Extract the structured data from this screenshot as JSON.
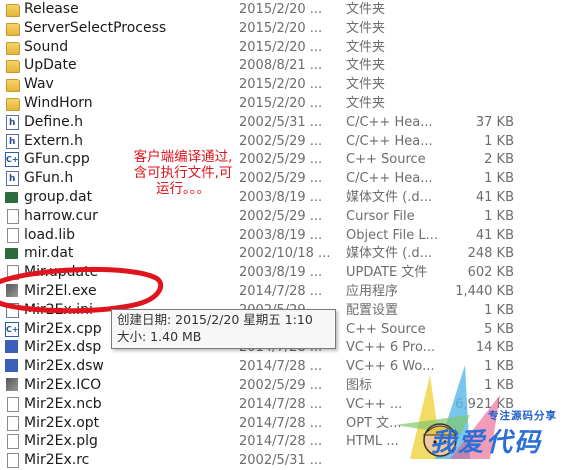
{
  "files": [
    {
      "name": "Release",
      "date": "2015/2/20 ...",
      "type": "文件夹",
      "size": "",
      "icon": "folder-icon"
    },
    {
      "name": "ServerSelectProcess",
      "date": "2015/2/20 ...",
      "type": "文件夹",
      "size": "",
      "icon": "folder-icon"
    },
    {
      "name": "Sound",
      "date": "2015/2/20 ...",
      "type": "文件夹",
      "size": "",
      "icon": "folder-icon"
    },
    {
      "name": "UpDate",
      "date": "2008/8/21 ...",
      "type": "文件夹",
      "size": "",
      "icon": "folder-icon"
    },
    {
      "name": "Wav",
      "date": "2015/2/20 ...",
      "type": "文件夹",
      "size": "",
      "icon": "folder-icon"
    },
    {
      "name": "WindHorn",
      "date": "2015/2/20 ...",
      "type": "文件夹",
      "size": "",
      "icon": "folder-icon"
    },
    {
      "name": "Define.h",
      "date": "2002/5/31 ...",
      "type": "C/C++ Hea...",
      "size": "37 KB",
      "icon": "h-file-icon"
    },
    {
      "name": "Extern.h",
      "date": "2002/5/29 ...",
      "type": "C/C++ Hea...",
      "size": "1 KB",
      "icon": "h-file-icon"
    },
    {
      "name": "GFun.cpp",
      "date": "2002/5/29 ...",
      "type": "C++ Source",
      "size": "2 KB",
      "icon": "cpp-file-icon"
    },
    {
      "name": "GFun.h",
      "date": "2002/5/29 ...",
      "type": "C/C++ Hea...",
      "size": "1 KB",
      "icon": "h-file-icon"
    },
    {
      "name": "group.dat",
      "date": "2003/8/19 ...",
      "type": "媒体文件 (.d...",
      "size": "41 KB",
      "icon": "dat-file-icon"
    },
    {
      "name": "harrow.cur",
      "date": "2002/5/29 ...",
      "type": "Cursor File",
      "size": "1 KB",
      "icon": "cur-file-icon"
    },
    {
      "name": "load.lib",
      "date": "2003/8/19 ...",
      "type": "Object File L...",
      "size": "41 KB",
      "icon": "file-icon"
    },
    {
      "name": "mir.dat",
      "date": "2002/10/18 ...",
      "type": "媒体文件 (.d...",
      "size": "248 KB",
      "icon": "dat-file-icon"
    },
    {
      "name": "Mir.update",
      "date": "2003/8/19 ...",
      "type": "UPDATE 文件",
      "size": "602 KB",
      "icon": "file-icon"
    },
    {
      "name": "Mir2El.exe",
      "date": "2014/7/28 ...",
      "type": "应用程序",
      "size": "1,440 KB",
      "icon": "exe-file-icon"
    },
    {
      "name": "Mir2Ex.ini",
      "date": "2002/5/29 ...",
      "type": "配置设置",
      "size": "1 KB",
      "icon": "ini-file-icon"
    },
    {
      "name": "Mir2Ex.cpp",
      "date": "2002/5/29 ...",
      "type": "C++ Source",
      "size": "5 KB",
      "icon": "cpp-file-icon"
    },
    {
      "name": "Mir2Ex.dsp",
      "date": "2014/7/28 ...",
      "type": "VC++ 6 Pro...",
      "size": "14 KB",
      "icon": "vc-file-icon"
    },
    {
      "name": "Mir2Ex.dsw",
      "date": "2014/7/28 ...",
      "type": "VC++ 6 Wo...",
      "size": "1 KB",
      "icon": "vc-file-icon"
    },
    {
      "name": "Mir2Ex.ICO",
      "date": "2002/5/29 ...",
      "type": "图标",
      "size": "1 KB",
      "icon": "ico-file-icon"
    },
    {
      "name": "Mir2Ex.ncb",
      "date": "2014/7/28 ...",
      "type": "VC++ ...",
      "size": "6,921 KB",
      "icon": "file-icon"
    },
    {
      "name": "Mir2Ex.opt",
      "date": "2014/7/28 ...",
      "type": "OPT 文...",
      "size": "",
      "icon": "file-icon"
    },
    {
      "name": "Mir2Ex.plg",
      "date": "2014/7/28 ...",
      "type": "HTML ...",
      "size": "",
      "icon": "file-icon"
    },
    {
      "name": "Mir2Ex.rc",
      "date": "2002/5/31 ...",
      "type": "",
      "size": "",
      "icon": "file-icon"
    }
  ],
  "tooltip": {
    "created": "创建日期: 2015/2/20 星期五 1:10",
    "size": "大小: 1.40 MB"
  },
  "annotation": {
    "line1": "客户端编译通过,",
    "line2": "含可执行文件,可",
    "line3": "运行。。。"
  },
  "watermark": {
    "tagline": "专注源码分享",
    "brand": "我爱代码"
  },
  "colors": {
    "annotation": "#e0141c",
    "watermark": "#2b6fd8",
    "folder": "#e6b53a"
  }
}
